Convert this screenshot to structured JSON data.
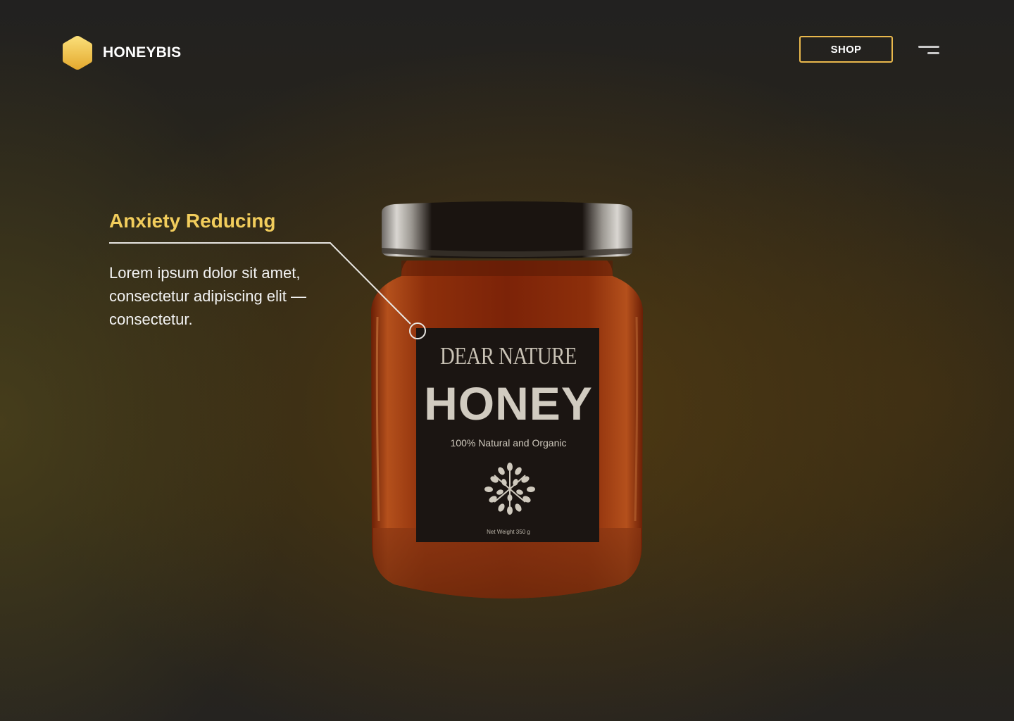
{
  "brand": {
    "name": "HONEYBIS",
    "logo_icon": "hexagon-logo-icon",
    "logo_color": "#f2c94c"
  },
  "header": {
    "shop_label": "SHOP",
    "menu_icon": "hamburger-menu-icon"
  },
  "feature": {
    "title": "Anxiety Reducing",
    "description": "Lorem ipsum dolor sit amet, consectetur adipiscing elit — consectetur."
  },
  "product": {
    "label_brand": "DEAR NATURE",
    "label_name": "HONEY",
    "label_tagline": "100% Natural and Organic",
    "label_weight": "Net Weight 350 g",
    "emblem_icon": "leaf-emblem-icon"
  },
  "colors": {
    "accent": "#f2cd5c",
    "button_border": "#e9b84c",
    "honey": "#8a2e0a",
    "label_bg": "#1b1512"
  }
}
